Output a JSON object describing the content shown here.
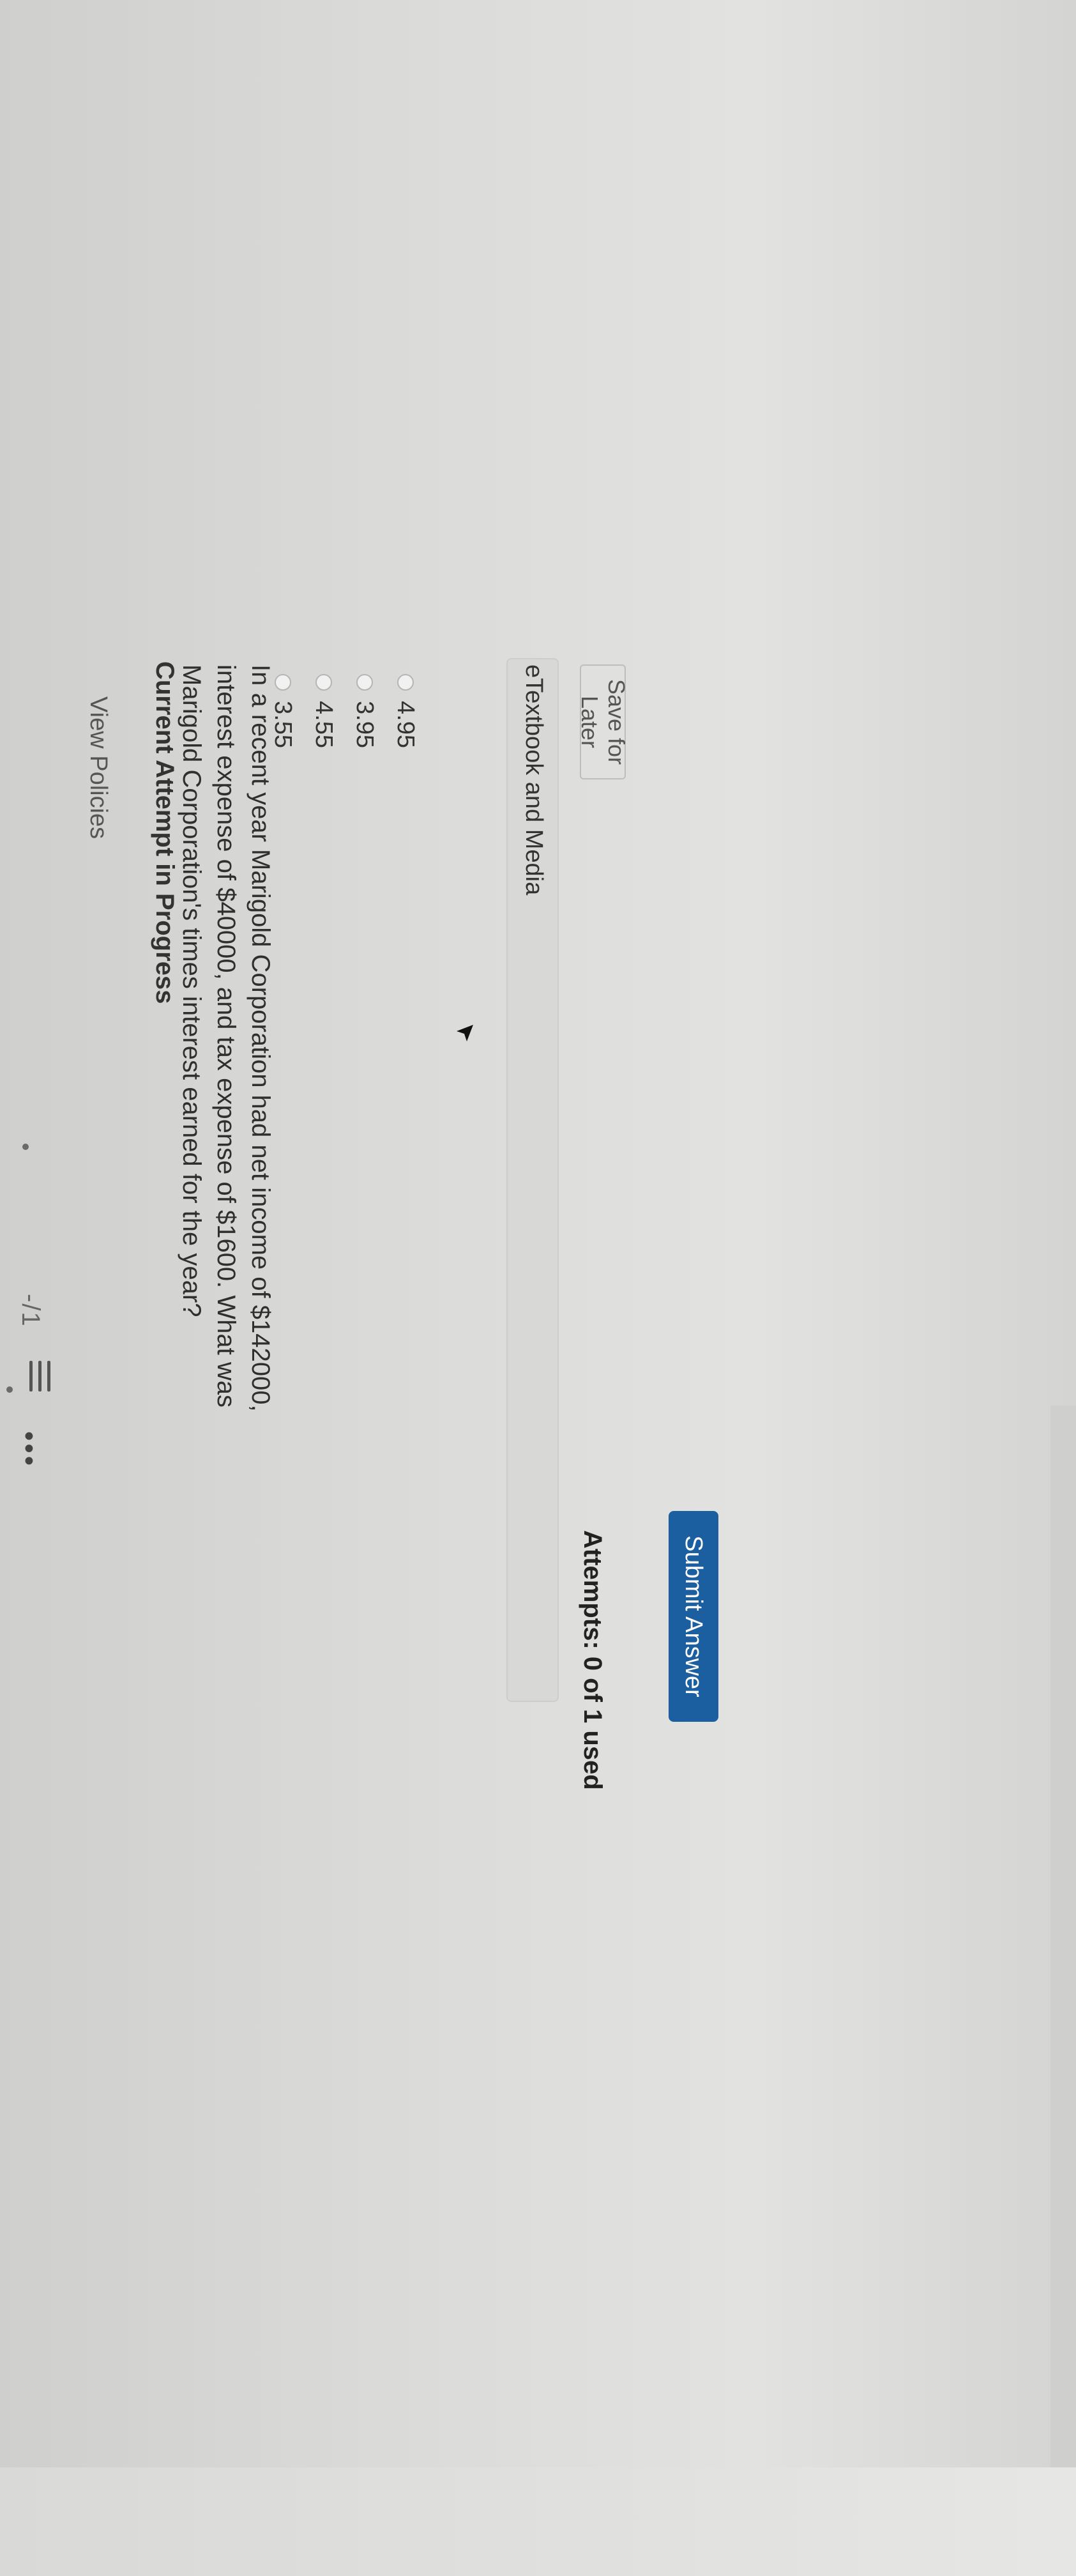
{
  "header": {
    "view_policies": "View Policies",
    "page_indicator": "-/1",
    "list_icon": "list-icon",
    "more_icon": "more-vertical-icon"
  },
  "attempt": {
    "heading": "Current Attempt in Progress"
  },
  "question": {
    "text": "In a recent year Marigold Corporation had net income of $142000, interest expense of $40000, and tax expense of $1600. What was Marigold Corporation's times interest earned for the year?",
    "options": [
      {
        "label": "4.95"
      },
      {
        "label": "3.95"
      },
      {
        "label": "4.55"
      },
      {
        "label": "3.55"
      }
    ]
  },
  "etextbook": {
    "label": "eTextbook and Media"
  },
  "footer": {
    "save_later": "Save for Later",
    "attempts": "Attempts: 0 of 1 used",
    "submit": "Submit Answer"
  },
  "colors": {
    "submit_bg": "#1c5fa0",
    "background": "#dadad8"
  }
}
